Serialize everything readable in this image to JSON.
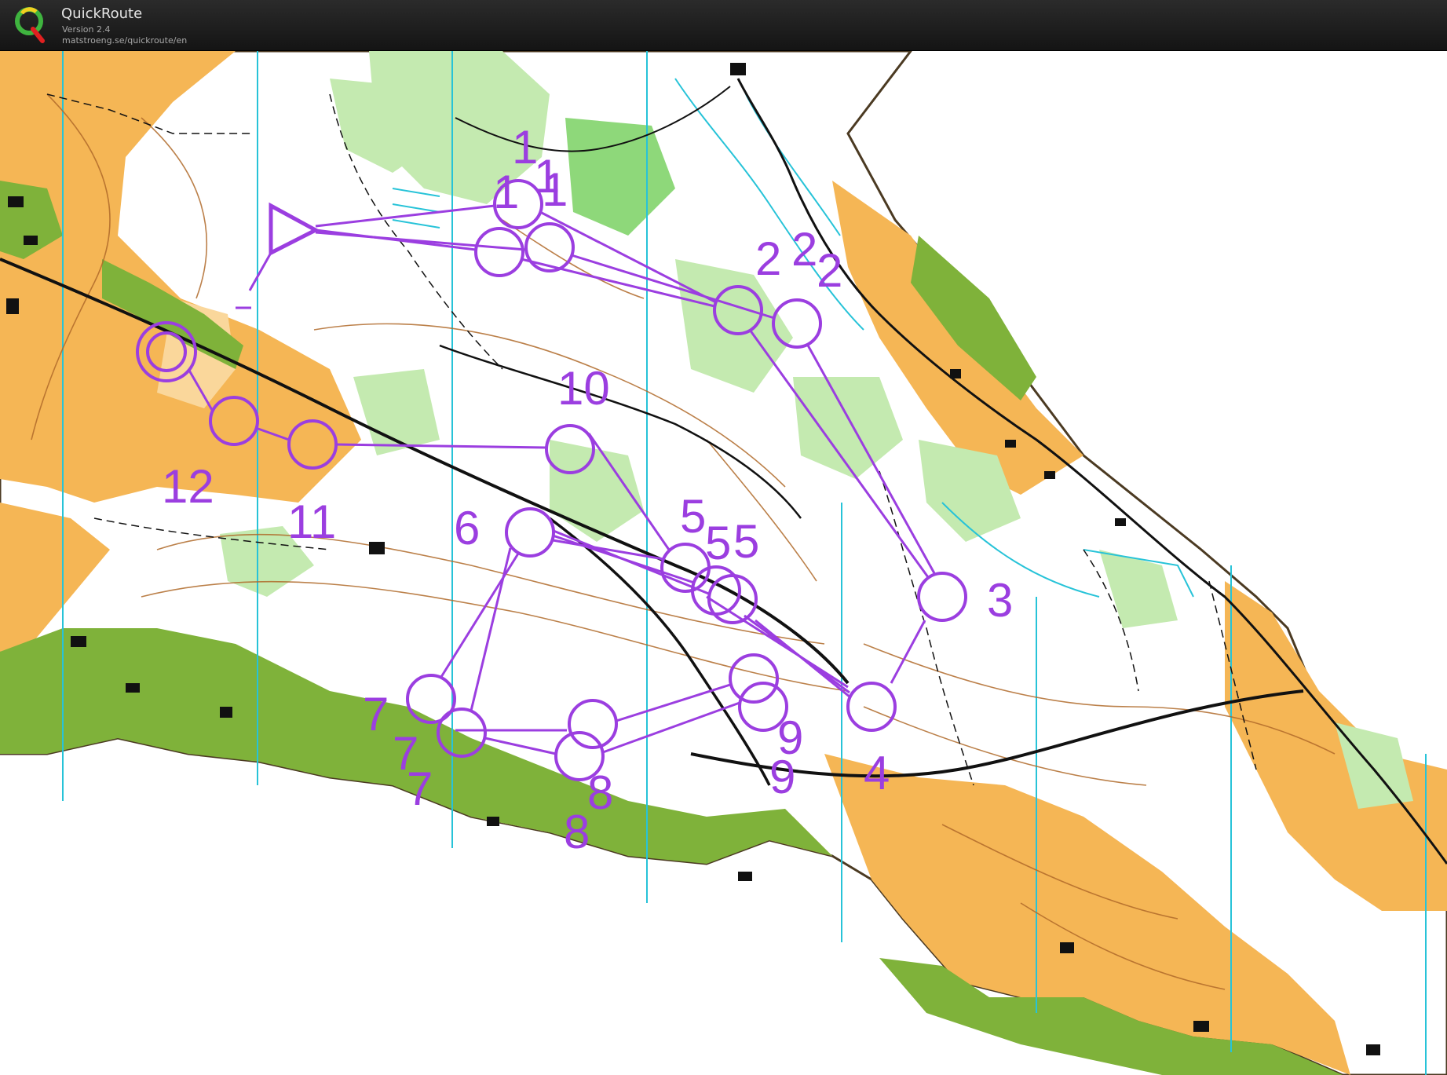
{
  "header": {
    "app_name": "QuickRoute",
    "version": "Version 2.4",
    "url": "matstroeng.se/quickroute/en",
    "logo_letter": "Q"
  },
  "map": {
    "kind": "orienteering map",
    "course_color": "#9b3ee0",
    "colors": {
      "open_land": "#f5b655",
      "rough_open": "#fad79b",
      "forest": "#ffffff",
      "green_light": "#c4eab0",
      "green_mid": "#8ed87a",
      "green_dark": "#7fb23a",
      "contour": "#b06a2a",
      "water": "#27c3d8",
      "black": "#111111"
    },
    "control_labels": [
      "1",
      "1",
      "1",
      "1",
      "2",
      "2",
      "2",
      "3",
      "4",
      "5",
      "5",
      "5",
      "6",
      "7",
      "7",
      "7",
      "8",
      "8",
      "9",
      "9",
      "10",
      "11",
      "12"
    ]
  }
}
